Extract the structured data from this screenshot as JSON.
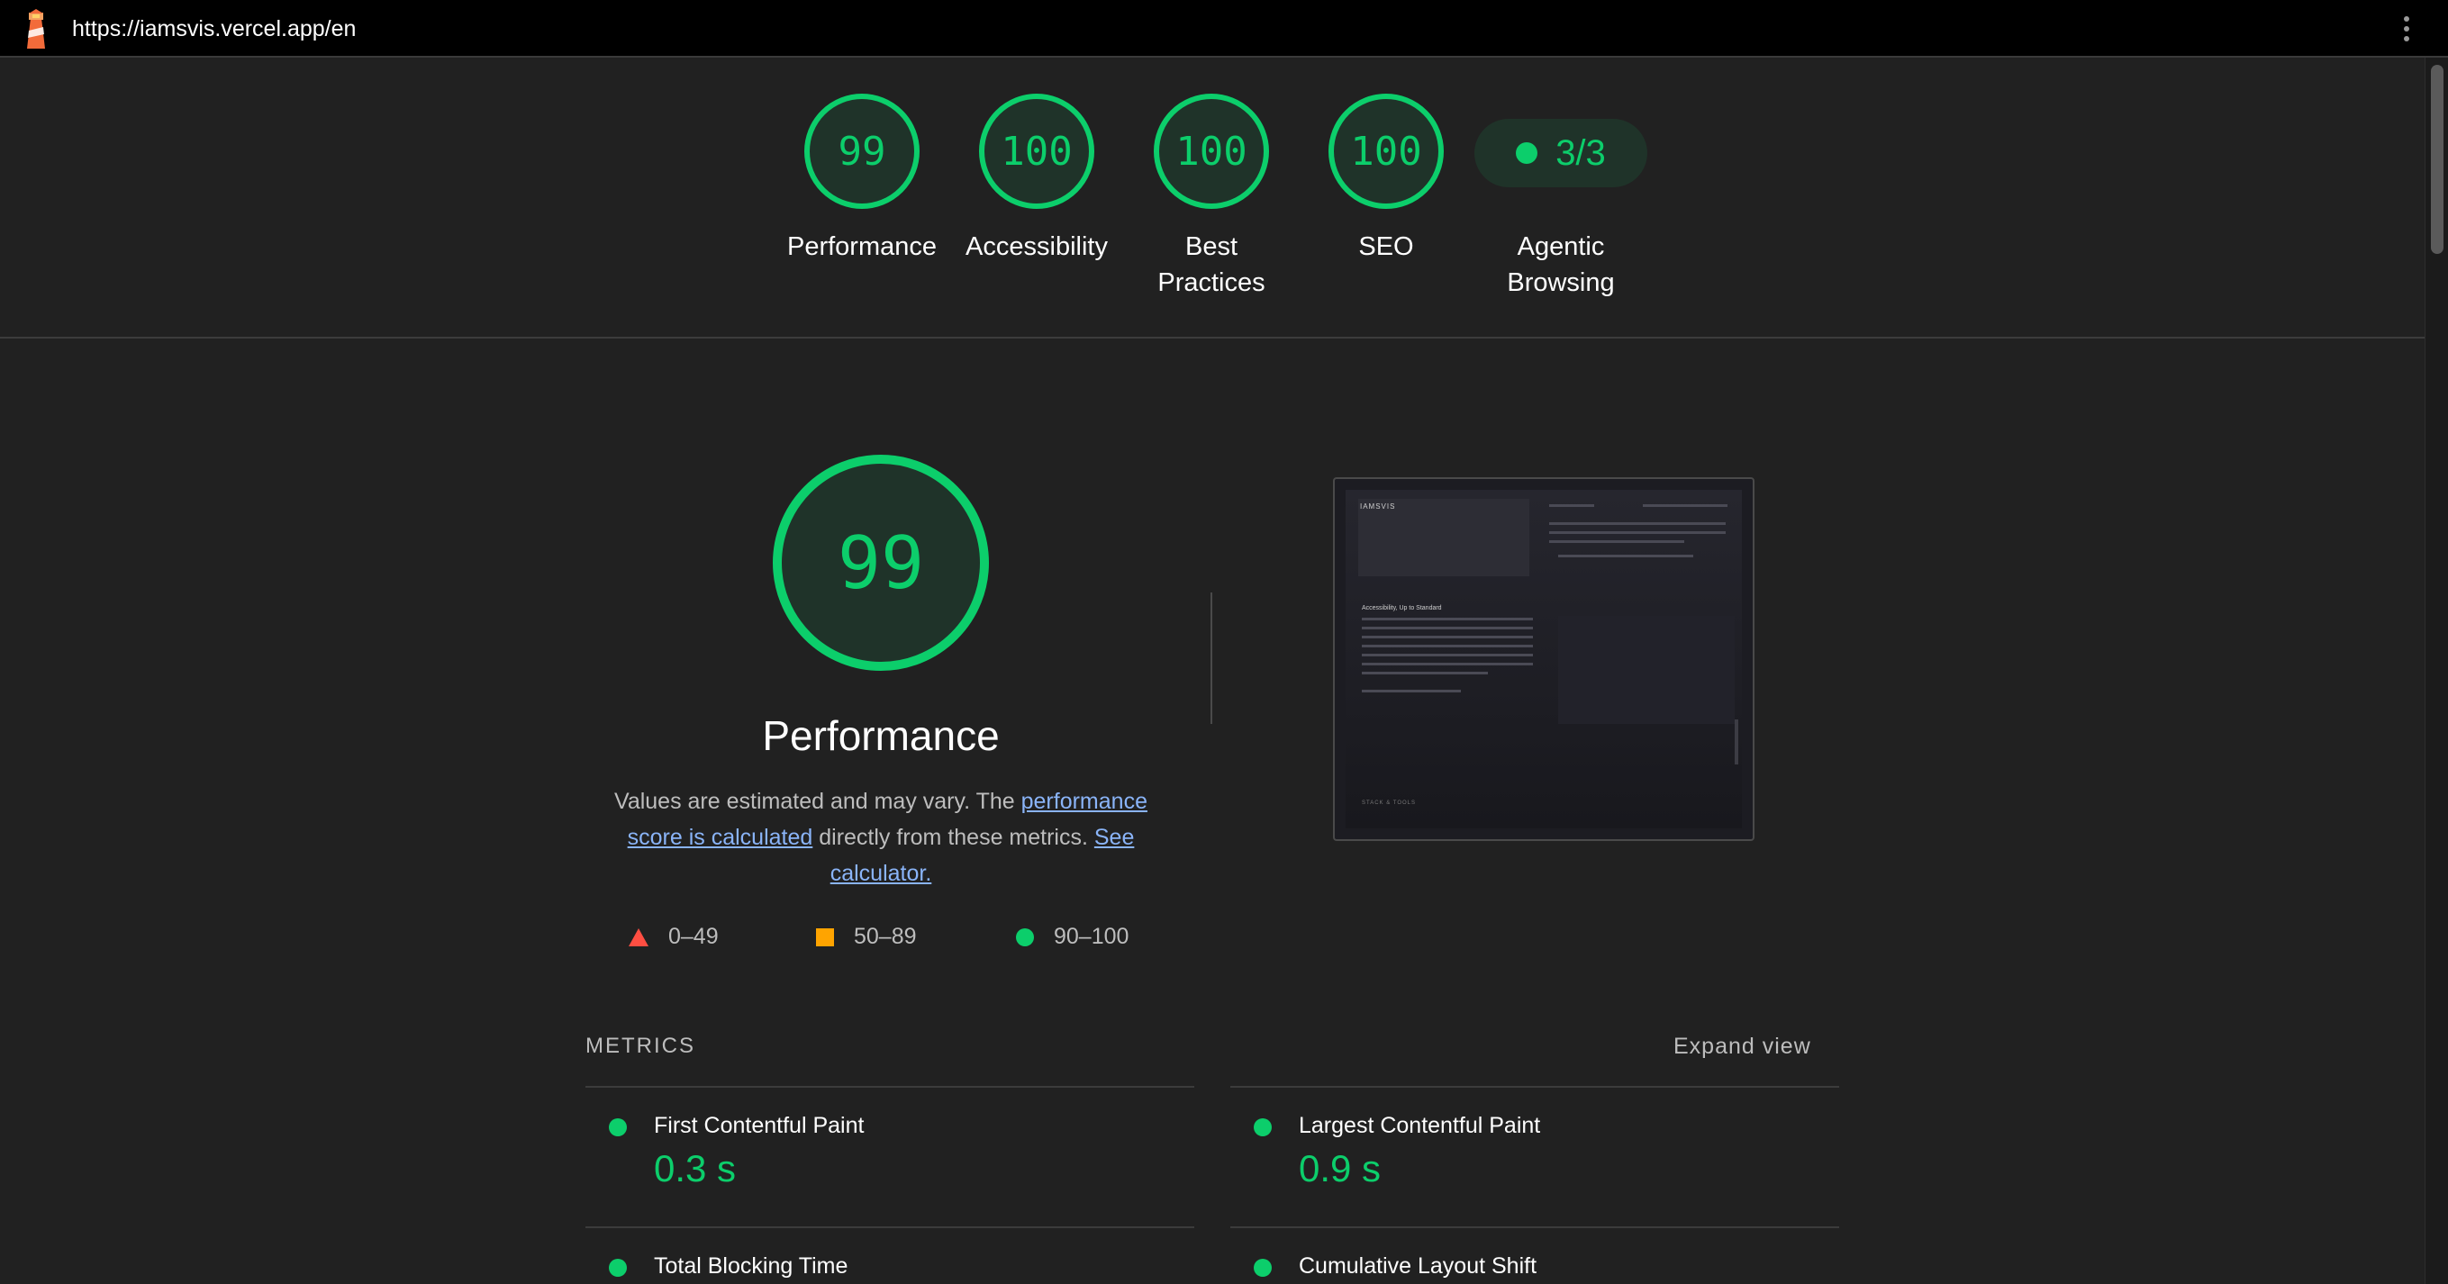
{
  "topbar": {
    "url": "https://iamsvis.vercel.app/en"
  },
  "summary": {
    "gauges": [
      {
        "score": "99",
        "label": "Performance"
      },
      {
        "score": "100",
        "label": "Accessibility"
      },
      {
        "score": "100",
        "label": "Best Practices"
      },
      {
        "score": "100",
        "label": "SEO"
      }
    ],
    "agentic": {
      "value": "3/3",
      "label": "Agentic Browsing"
    }
  },
  "performance": {
    "score": "99",
    "title": "Performance",
    "desc_prefix": "Values are estimated and may vary. The ",
    "desc_link1": "performance score is calculated",
    "desc_middle": " directly from these metrics. ",
    "desc_link2": "See calculator."
  },
  "legend": {
    "fail": "0–49",
    "average": "50–89",
    "pass": "90–100"
  },
  "thumbnail": {
    "brand": "IAMSVIS",
    "heading": "Accessibility, Up to Standard",
    "footer": "STACK & TOOLS"
  },
  "metrics": {
    "header": "METRICS",
    "expand": "Expand view",
    "items": [
      {
        "title": "First Contentful Paint",
        "value": "0.3 s"
      },
      {
        "title": "Largest Contentful Paint",
        "value": "0.9 s"
      },
      {
        "title": "Total Blocking Time",
        "value": ""
      },
      {
        "title": "Cumulative Layout Shift",
        "value": ""
      }
    ]
  },
  "colors": {
    "pass": "#0cce6b",
    "average": "#ffa400",
    "fail": "#ff4e42",
    "background": "#212121"
  }
}
